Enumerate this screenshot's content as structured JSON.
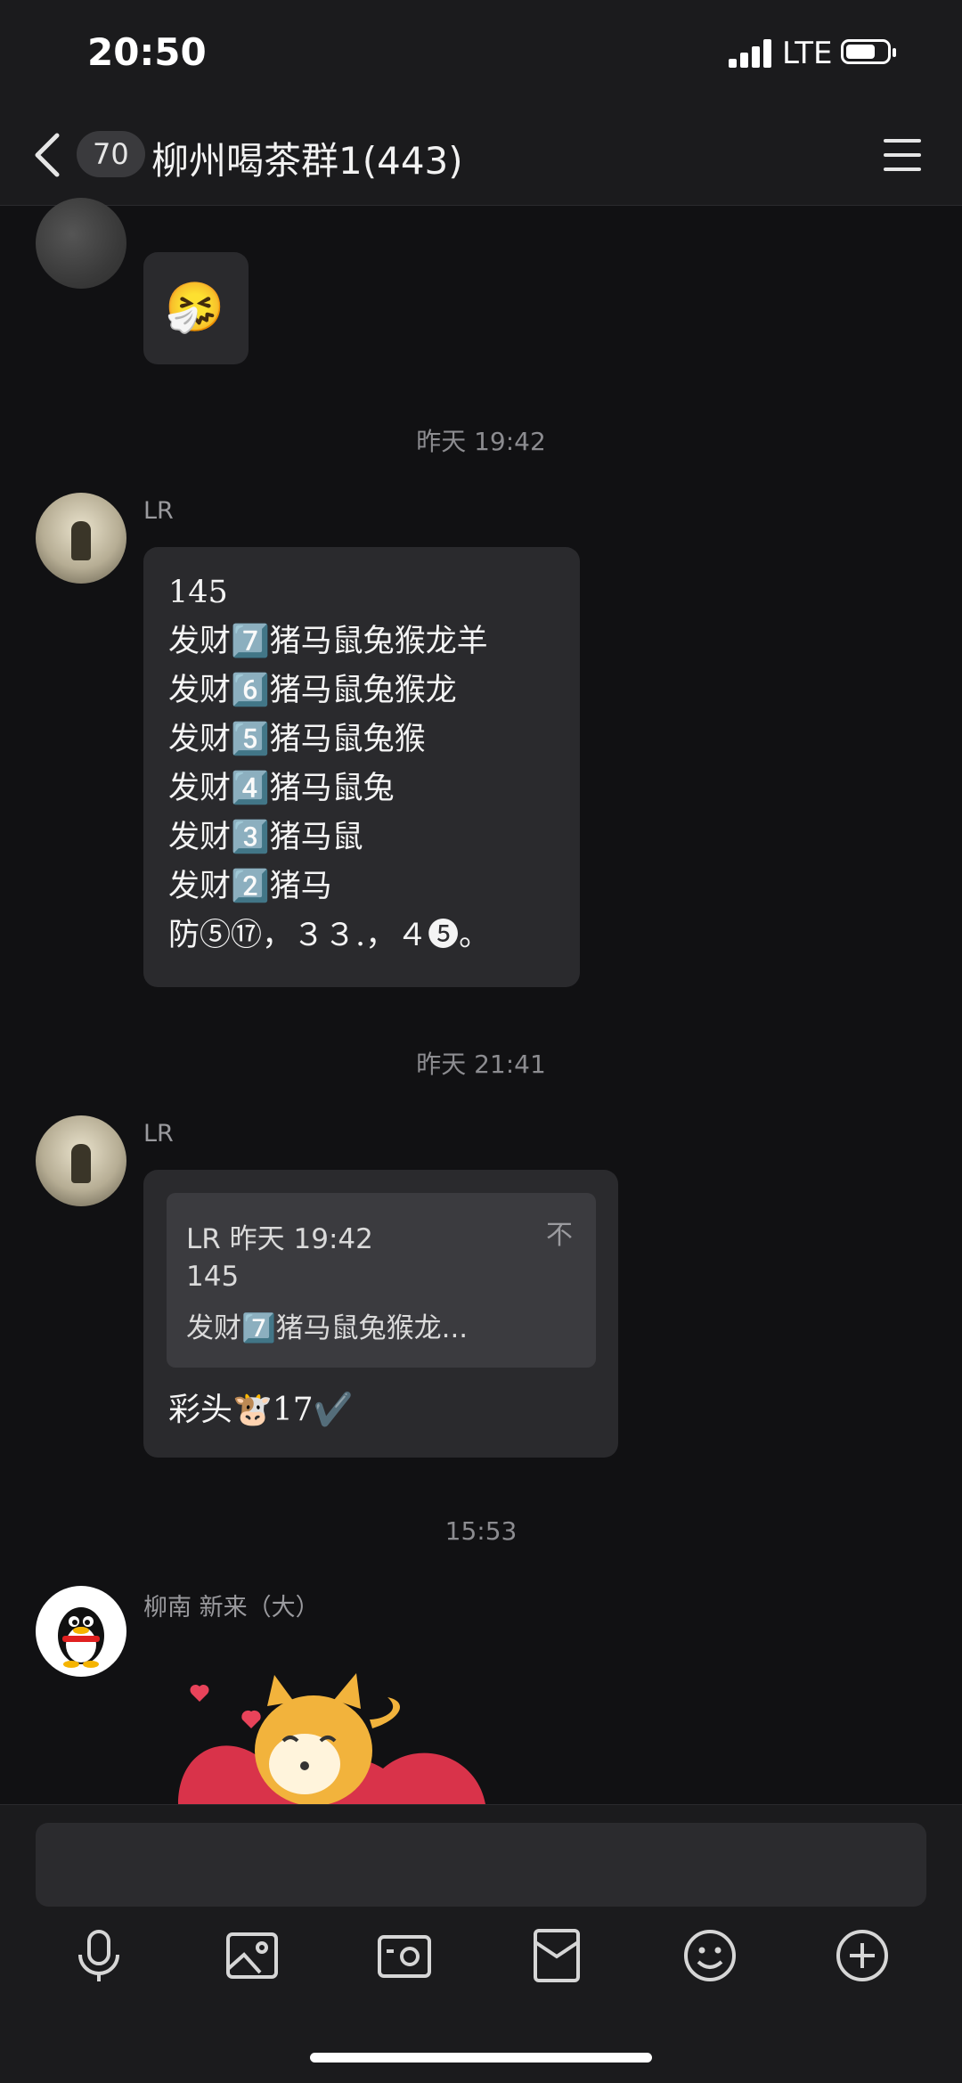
{
  "status_bar": {
    "time": "20:50",
    "network": "LTE"
  },
  "nav": {
    "unread_count": "70",
    "title": "柳州喝茶群1(443)"
  },
  "messages": {
    "top_emoji": "🤧",
    "time1": "昨天 19:42",
    "msg1": {
      "sender": "LR",
      "lines": [
        "145",
        "发财7️⃣猪马鼠兔猴龙羊",
        "发财6️⃣猪马鼠兔猴龙",
        "发财5️⃣猪马鼠兔猴",
        "发财4️⃣猪马鼠兔",
        "发财3️⃣猪马鼠",
        "发财2️⃣猪马",
        "防⑤⑰，３３.，４❺。"
      ]
    },
    "time2": "昨天 21:41",
    "msg2": {
      "sender": "LR",
      "quote_header": "LR 昨天 19:42",
      "quote_line1": "145",
      "quote_line2": "发财7️⃣猪马鼠兔猴龙...",
      "quote_pin": "不",
      "reply": "彩头🐮17✔️"
    },
    "time3": "15:53",
    "msg3": {
      "sender": "柳南 新来（大）"
    }
  },
  "toolbar": {
    "icons": [
      "microphone-icon",
      "image-icon",
      "camera-icon",
      "red-packet-icon",
      "emoji-icon",
      "plus-icon"
    ]
  },
  "colors": {
    "background": "#111113",
    "bubble": "#2a2a2d",
    "bar": "#1b1b1d"
  }
}
